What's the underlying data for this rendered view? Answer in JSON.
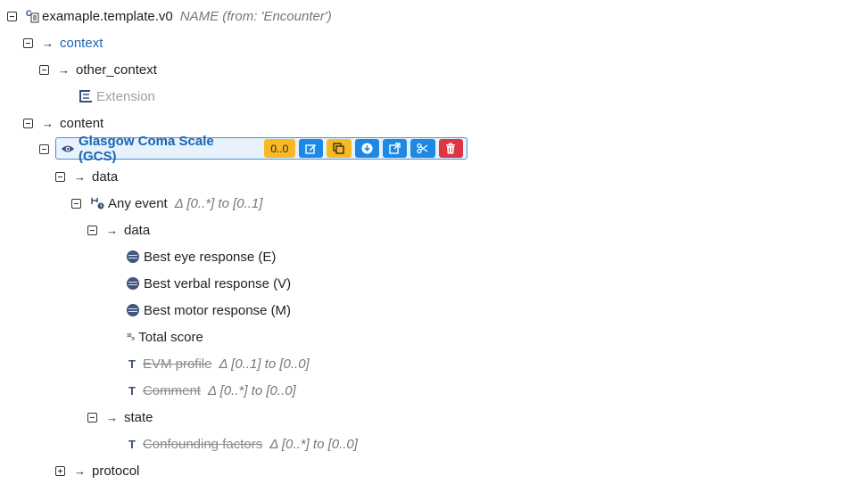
{
  "tree": {
    "root": {
      "name": "examaple.template.v0",
      "meta": "NAME (from: 'Encounter')"
    },
    "context": {
      "label": "context"
    },
    "other_context": {
      "label": "other_context"
    },
    "extension": {
      "label": "Extension"
    },
    "content": {
      "label": "content"
    },
    "gcs": {
      "label": "Glasgow Coma Scale (GCS)",
      "occurrence": "0..0",
      "buttons": [
        "edit",
        "copy",
        "download",
        "open-external",
        "cut",
        "delete"
      ]
    },
    "data1": {
      "label": "data"
    },
    "any_event": {
      "label": "Any event",
      "meta": "Δ [0..*] to [0..1]"
    },
    "data2": {
      "label": "data"
    },
    "best_eye": {
      "label": "Best eye response (E)"
    },
    "best_verbal": {
      "label": "Best verbal response (V)"
    },
    "best_motor": {
      "label": "Best motor response (M)"
    },
    "total_score": {
      "label": "Total score"
    },
    "evm_profile": {
      "label": "EVM profile",
      "meta": "Δ [0..1] to [0..0]"
    },
    "comment": {
      "label": "Comment",
      "meta": "Δ [0..*] to [0..0]"
    },
    "state": {
      "label": "state"
    },
    "confounding": {
      "label": "Confounding factors",
      "meta": "Δ [0..*] to [0..0]"
    },
    "protocol": {
      "label": "protocol"
    }
  },
  "colors": {
    "link": "#1a66b3",
    "selection_border": "#4a90d9",
    "btn_blue": "#1e88e5",
    "btn_yellow": "#f7b924",
    "btn_red": "#dc3545"
  }
}
